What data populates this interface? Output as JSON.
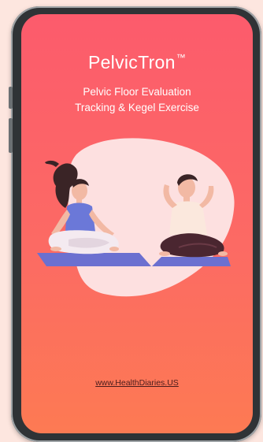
{
  "app": {
    "title": "PelvicTron",
    "trademark": "™",
    "subtitle_line1": "Pelvic Floor Evaluation",
    "subtitle_line2": "Tracking & Kegel Exercise",
    "website_link": "www.HealthDiaries.US"
  },
  "colors": {
    "screen_top": "#fc5b6c",
    "screen_bottom": "#fd7a53",
    "blob": "#fde0e0",
    "mat": "#6b70d0"
  },
  "illustration": {
    "subject": "woman and man meditating on yoga mats"
  }
}
